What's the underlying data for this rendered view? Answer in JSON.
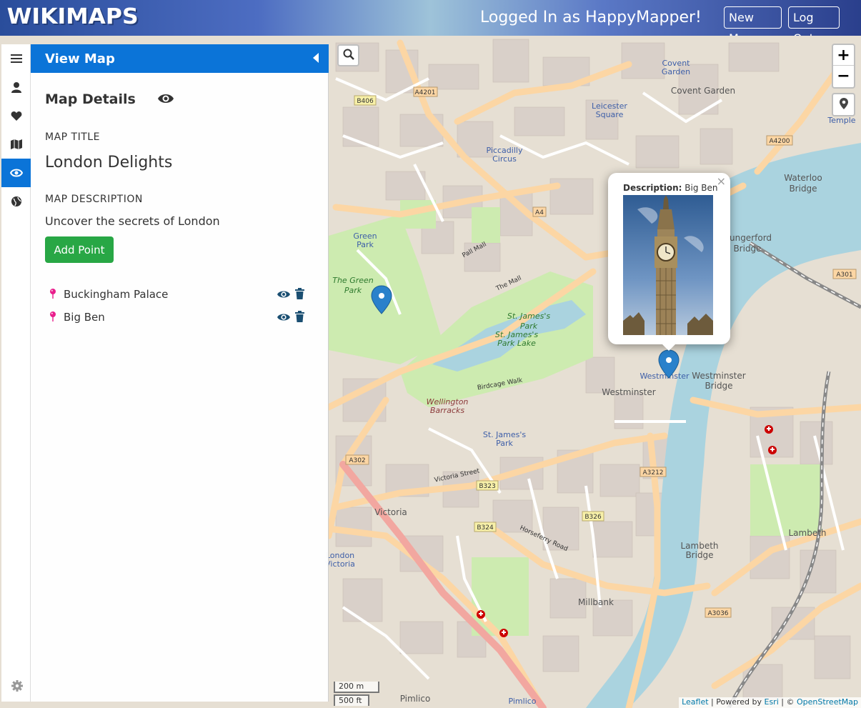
{
  "header": {
    "logo": "WIKIMAPS",
    "logged_in_text": "Logged In as HappyMapper!",
    "new_map_label": "New Map",
    "logout_label": "Log Out"
  },
  "rail": {
    "items": [
      "menu-icon",
      "user-icon",
      "heart-icon",
      "map-icon",
      "eye-icon",
      "globe-icon"
    ],
    "active": "eye-icon",
    "footer": "gear-icon"
  },
  "panel": {
    "header_title": "View Map",
    "details_title": "Map Details",
    "map_title_label": "MAP TITLE",
    "map_title": "London Delights",
    "map_description_label": "MAP DESCRIPTION",
    "map_description": "Uncover the secrets of London",
    "add_point_label": "Add Point",
    "points": [
      {
        "name": "Buckingham Palace"
      },
      {
        "name": "Big Ben"
      }
    ]
  },
  "popup": {
    "description_label": "Description:",
    "description_value": "Big Ben",
    "close_label": "×"
  },
  "map_labels": {
    "leicester_square": "Leicester Square",
    "covent_garden": "Covent Garden",
    "piccadilly_circus": "Piccadilly Circus",
    "green_park": "Green Park",
    "the_green_park": "The Green Park",
    "st_james_park": "St. James's Park",
    "st_james_park_lake": "St. James's Park Lake",
    "st_james_park_station": "St. James's Park",
    "westminster": "Westminster",
    "westminster_station": "Westminster",
    "westminster_bridge": "Westminster Bridge",
    "waterloo_bridge": "Waterloo Bridge",
    "hungerford_bridge": "Hungerford Bridge",
    "lambeth_bridge": "Lambeth Bridge",
    "lambeth": "Lambeth",
    "victoria": "Victoria",
    "millbank": "Millbank",
    "pimlico": "Pimlico",
    "wellington_barracks": "Wellington Barracks",
    "the_mall": "The Mall",
    "pall_mall": "Pall Mall",
    "victoria_street": "Victoria Street",
    "horseferry_road": "Horseferry Road",
    "birdcage_walk": "Birdcage Walk",
    "temple": "Temple",
    "a4201": "A4201",
    "b406": "B406",
    "a4": "A4",
    "a4200": "A4200",
    "a301": "A301",
    "a302": "A302",
    "b323": "B323",
    "b324": "B324",
    "b326": "B326",
    "a3212": "A3212",
    "a3036": "A3036"
  },
  "scale": {
    "metric": "200 m",
    "imperial": "500 ft"
  },
  "attribution": {
    "leaflet": "Leaflet",
    "powered": " | Powered by ",
    "esri": "Esri",
    "copy": " | © ",
    "osm": "OpenStreetMap"
  },
  "colors": {
    "primary": "#0b74d8",
    "success": "#28a745",
    "marker": "#2a81cb",
    "pin": "#e91e8c",
    "water": "#aad3df",
    "park": "#c8facc",
    "road_major": "#fcd6a4"
  }
}
